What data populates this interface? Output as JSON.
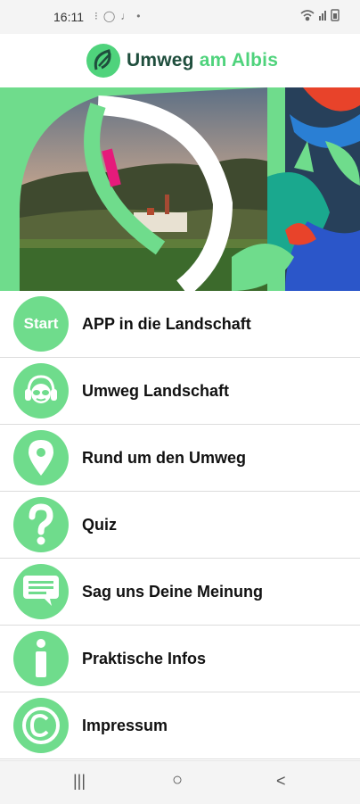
{
  "status_bar": {
    "time": "16:11",
    "left_icons": [
      "notification-icon",
      "circle-icon",
      "mic-icon",
      "dot-icon"
    ],
    "right_icons": [
      "wifi-icon",
      "signal-icon",
      "signal-icon",
      "battery-icon"
    ]
  },
  "header": {
    "logo_word1": "Umweg",
    "logo_word2": "am Albis",
    "colors": {
      "dark_green": "#1f4e3d",
      "light_green": "#4fd37c"
    }
  },
  "menu": {
    "accent": "#6fdc8c",
    "items": [
      {
        "icon": "start-icon",
        "icon_text": "Start",
        "label": "APP in die Landschaft"
      },
      {
        "icon": "headphones-face-icon",
        "label": "Umweg Landschaft"
      },
      {
        "icon": "map-pin-icon",
        "label": "Rund um den Umweg"
      },
      {
        "icon": "question-mark-icon",
        "label": "Quiz"
      },
      {
        "icon": "speech-bubble-icon",
        "label": "Sag uns Deine Meinung"
      },
      {
        "icon": "info-icon",
        "label": "Praktische Infos"
      },
      {
        "icon": "copyright-icon",
        "label": "Impressum"
      }
    ]
  },
  "nav_bar": {
    "recents": "|||",
    "home": "○",
    "back": "<"
  }
}
